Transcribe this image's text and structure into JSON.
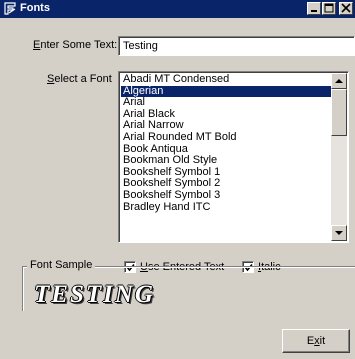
{
  "window": {
    "title": "Fonts",
    "title_icon": "fonts-app-icon",
    "controls": [
      "minimize-icon",
      "maximize-icon",
      "close-icon"
    ]
  },
  "enter_text": {
    "label_pre": "",
    "label_accel": "E",
    "label_post": "nter Some Text:",
    "value": "Testing"
  },
  "select_font": {
    "label_pre": "",
    "label_accel": "S",
    "label_post": "elect a Font",
    "selected": "Algerian",
    "items": [
      "Abadi MT Condensed",
      "Algerian",
      "Arial",
      "Arial Black",
      "Arial Narrow",
      "Arial Rounded MT Bold",
      "Book Antiqua",
      "Bookman Old Style",
      "Bookshelf Symbol 1",
      "Bookshelf Symbol 2",
      "Bookshelf Symbol 3",
      "Bradley Hand ITC"
    ]
  },
  "options": {
    "use_entered": {
      "accel": "U",
      "rest": "se Entered Text",
      "checked": true
    },
    "italic": {
      "accel": "I",
      "rest": "talic",
      "checked": true
    }
  },
  "sample": {
    "group_label": "Font Sample",
    "text": "TESTING"
  },
  "exit": {
    "pre": "E",
    "accel": "x",
    "post": "it"
  },
  "colors": {
    "titlebar": "#0a246a",
    "face": "#d4d0c8",
    "selection": "#0a246a"
  }
}
